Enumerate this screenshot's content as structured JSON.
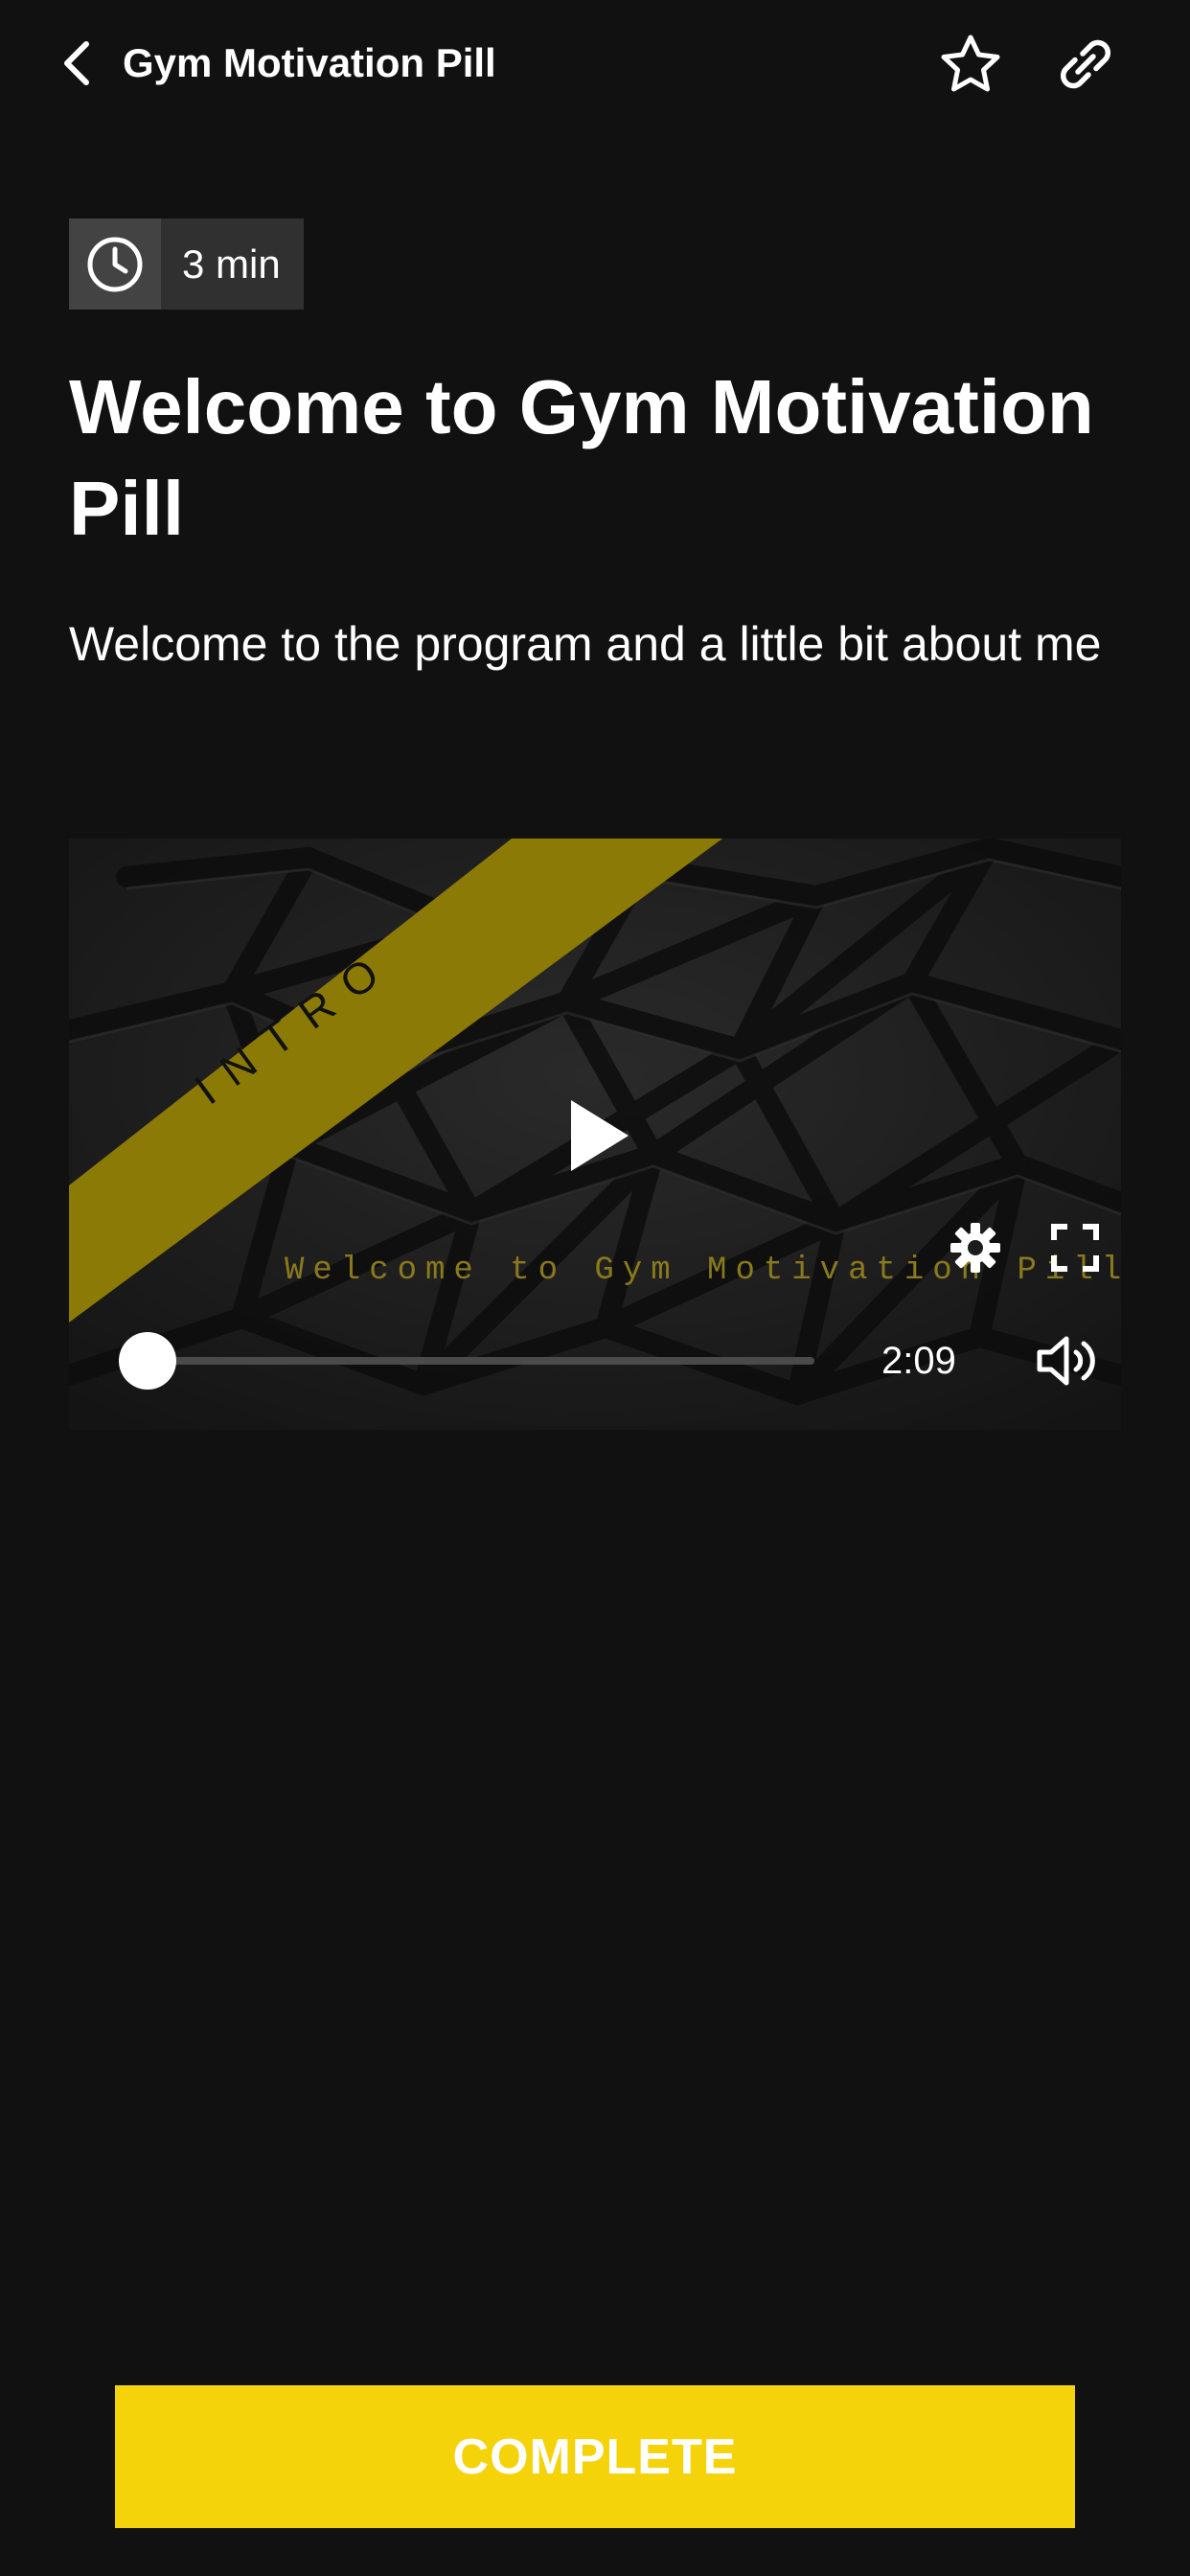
{
  "header": {
    "title": "Gym Motivation Pill",
    "back_icon": "chevron-left-icon",
    "favorite_icon": "star-outline-icon",
    "share_icon": "link-icon"
  },
  "lesson": {
    "duration_icon": "clock-icon",
    "duration": "3 min",
    "title": "Welcome to Gym Motivation Pill",
    "subtitle": "Welcome to the program and a little bit about me"
  },
  "video": {
    "banner_text": "INTRO",
    "caption": "Welcome to Gym Motivation Pill",
    "time_remaining": "2:09",
    "progress_fraction": 0.0,
    "play_icon": "play-icon",
    "settings_icon": "gear-icon",
    "fullscreen_icon": "fullscreen-icon",
    "volume_icon": "volume-icon"
  },
  "footer": {
    "complete_label": "COMPLETE"
  },
  "colors": {
    "background": "#111111",
    "accent": "#f5d30a",
    "banner": "#8c7a06",
    "badge_bg": "#303030",
    "badge_icon_bg": "#434343"
  }
}
